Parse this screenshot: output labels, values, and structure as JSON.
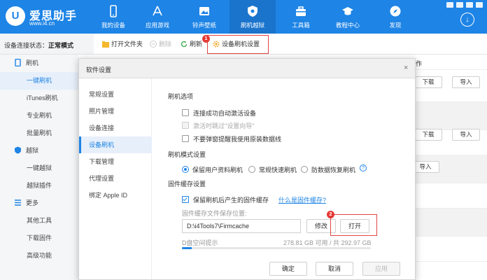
{
  "app": {
    "logo_mark": "U",
    "logo_title": "爱思助手",
    "logo_url": "www.i4.cn"
  },
  "nav": [
    {
      "label": "我的设备",
      "icon": "phone-icon"
    },
    {
      "label": "应用游戏",
      "icon": "app-store-icon"
    },
    {
      "label": "铃声壁纸",
      "icon": "wallpaper-icon"
    },
    {
      "label": "刷机越狱",
      "icon": "shield-icon"
    },
    {
      "label": "工具箱",
      "icon": "toolbox-icon"
    },
    {
      "label": "教程中心",
      "icon": "graduation-cap-icon"
    },
    {
      "label": "发现",
      "icon": "compass-icon"
    }
  ],
  "status": {
    "label": "设备连接状态：",
    "value": "正常模式"
  },
  "toolbar": {
    "open_folder": "打开文件夹",
    "delete": "删除",
    "refresh": "刷新",
    "flash_settings": "设备刷机设置",
    "badge": "1"
  },
  "sidebar": {
    "flash_group": "刷机",
    "flash_items": [
      "一键刷机",
      "iTunes刷机",
      "专业刷机",
      "批量刷机"
    ],
    "jailbreak_group": "越狱",
    "jailbreak_items": [
      "一键越狱",
      "越狱插件"
    ],
    "more_group": "更多",
    "more_items": [
      "其他工具",
      "下载固件",
      "高级功能"
    ]
  },
  "background_table": {
    "op_header": "作",
    "download_label": "下载",
    "import_label": "导入"
  },
  "dialog": {
    "title": "软件设置",
    "close": "×",
    "nav": [
      "常规设置",
      "照片管理",
      "设备连接",
      "设备刷机",
      "下载管理",
      "代理设置",
      "绑定 Apple ID"
    ],
    "active_nav": "设备刷机",
    "flash_options": {
      "heading": "刷机选项",
      "opt1": "连接成功自动激活设备",
      "opt1_checked": false,
      "opt2": "激活时跳过\"设置向导\"",
      "opt2_checked": false,
      "opt3": "不要弹窗提醒我使用原装数据线",
      "opt3_checked": false
    },
    "flash_mode": {
      "heading": "刷机模式设置",
      "modes": [
        "保留用户资料刷机",
        "常规快速刷机",
        "防数据恢复刷机"
      ],
      "selected": "保留用户资料刷机",
      "help": "?"
    },
    "firmware_cache": {
      "heading": "固件缓存设置",
      "keep_label": "保留刷机后产生的固件缓存",
      "keep_checked": true,
      "what_link": "什么是固件缓存?",
      "path_label": "固件缓存文件保存位置:",
      "path_value": "D:\\i4Tools7\\Firmcache",
      "modify": "修改",
      "open": "打开",
      "open_badge": "2",
      "disk_label": "D盘空间提示",
      "disk_usage": "278.81 GB 可用 / 共 292.97 GB",
      "disk_used_fraction": 0.05
    },
    "buttons": {
      "ok": "确定",
      "cancel": "取消",
      "apply": "应用"
    }
  },
  "colors": {
    "brand_blue": "#1e84e6",
    "highlight_red": "#e04545"
  }
}
